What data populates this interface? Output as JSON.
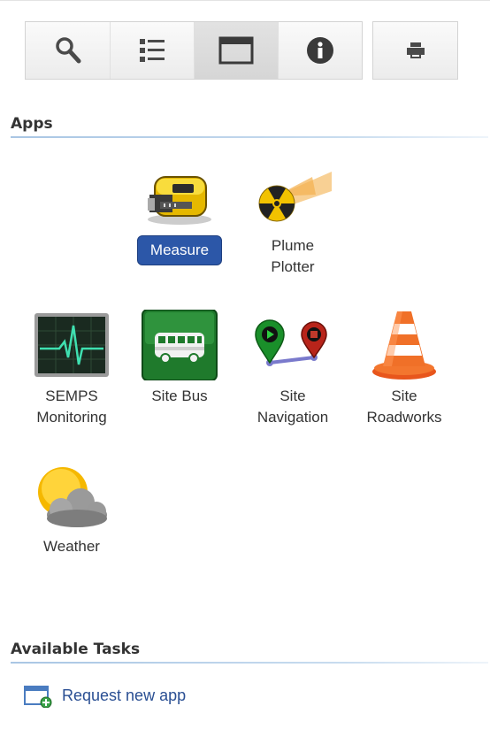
{
  "toolbar": {
    "buttons": [
      {
        "name": "search",
        "icon": "search-icon",
        "active": false
      },
      {
        "name": "list",
        "icon": "list-icon",
        "active": false
      },
      {
        "name": "window",
        "icon": "window-icon",
        "active": true
      },
      {
        "name": "info",
        "icon": "info-icon",
        "active": false
      }
    ],
    "print_icon": "print-icon"
  },
  "apps_section": {
    "title": "Apps",
    "items": [
      {
        "id": "measure",
        "label": "Measure",
        "icon": "tape-measure-icon",
        "selected": true
      },
      {
        "id": "plume-plotter",
        "label": "Plume\nPlotter",
        "icon": "radiation-plume-icon",
        "selected": false
      },
      {
        "id": "semps-monitoring",
        "label": "SEMPS\nMonitoring",
        "icon": "heart-monitor-icon",
        "selected": false
      },
      {
        "id": "site-bus",
        "label": "Site Bus",
        "icon": "bus-icon",
        "selected": false
      },
      {
        "id": "site-navigation",
        "label": "Site\nNavigation",
        "icon": "map-pins-icon",
        "selected": false
      },
      {
        "id": "site-roadworks",
        "label": "Site\nRoadworks",
        "icon": "traffic-cone-icon",
        "selected": false
      },
      {
        "id": "weather",
        "label": "Weather",
        "icon": "sun-cloud-icon",
        "selected": false
      }
    ]
  },
  "tasks_section": {
    "title": "Available Tasks",
    "items": [
      {
        "label": "Request new app",
        "icon": "new-window-icon"
      }
    ]
  },
  "colors": {
    "accent": "#2c57a8",
    "link": "#2a4f93",
    "rule": "#a9c6e4"
  }
}
